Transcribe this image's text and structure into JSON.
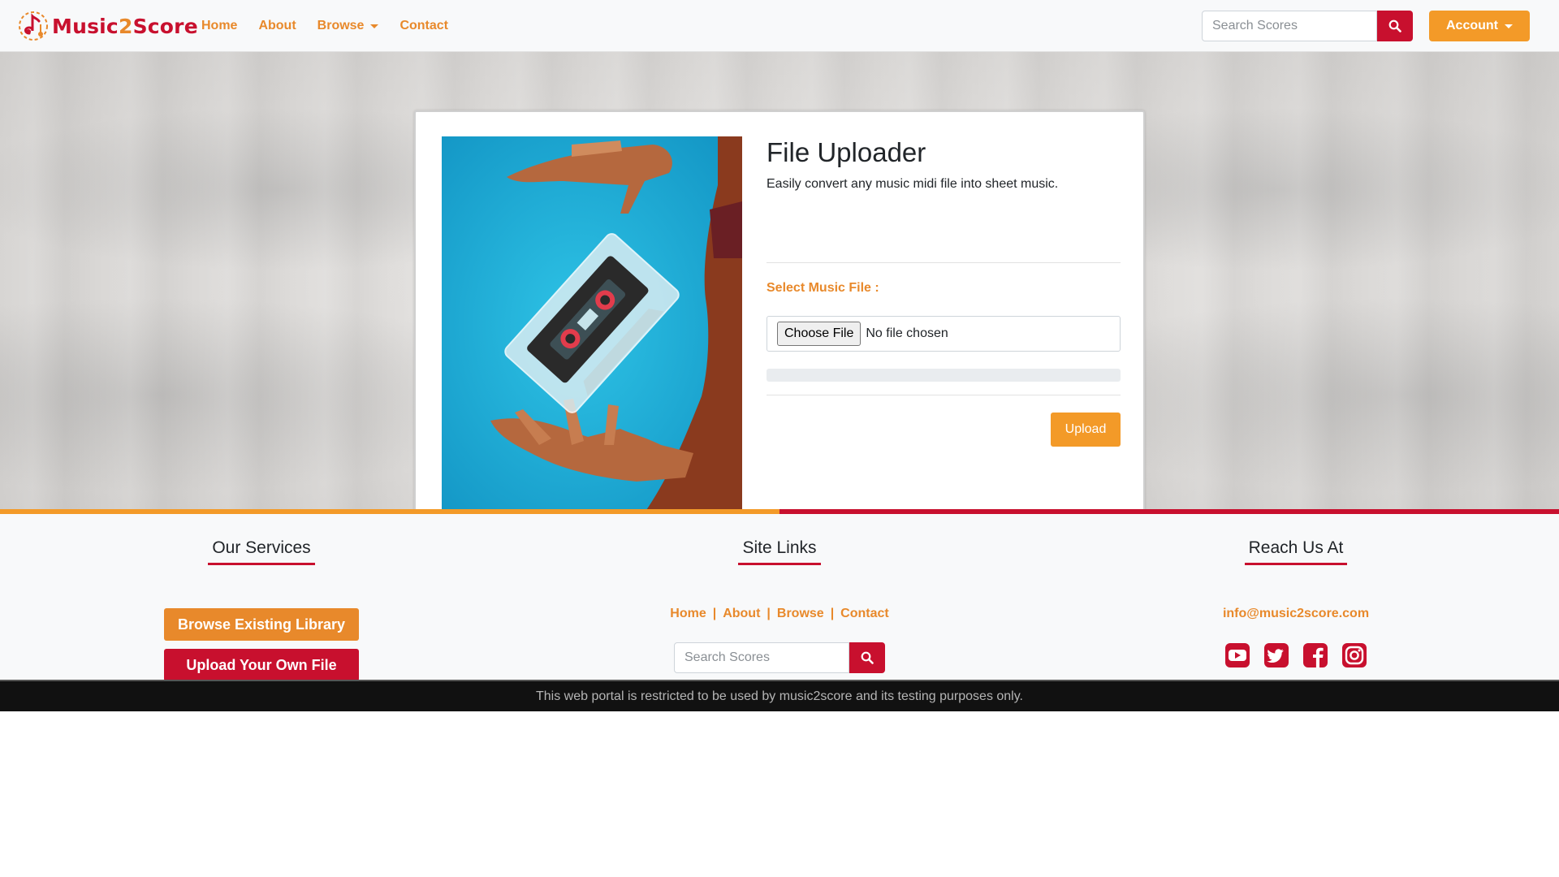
{
  "brand": {
    "name_part1": "Music",
    "name_part2": "2",
    "name_part3": "Score"
  },
  "nav": {
    "links": [
      {
        "label": "Home"
      },
      {
        "label": "About"
      },
      {
        "label": "Browse"
      },
      {
        "label": "Contact"
      }
    ],
    "search_placeholder": "Search Scores",
    "account_label": "Account"
  },
  "uploader": {
    "title": "File Uploader",
    "subtitle": "Easily convert any music midi file into sheet music.",
    "select_label": "Select Music File :",
    "choose_button": "Choose File",
    "file_status": "No file chosen",
    "progress": 0,
    "upload_button": "Upload"
  },
  "footer": {
    "services": {
      "title": "Our Services",
      "browse_button": "Browse Existing Library",
      "upload_button": "Upload Your Own File"
    },
    "site_links": {
      "title": "Site Links",
      "links": [
        "Home",
        "About",
        "Browse",
        "Contact"
      ],
      "separator": "|",
      "search_placeholder": "Search Scores"
    },
    "reach": {
      "title": "Reach Us At",
      "email": "info@music2score.com",
      "social_icons": [
        "youtube-icon",
        "twitter-icon",
        "facebook-icon",
        "instagram-icon"
      ]
    },
    "disclaimer": "This web portal is restricted to be used by music2score and its testing purposes only."
  },
  "colors": {
    "accent_orange": "#f39a28",
    "link_orange": "#e8892b",
    "brand_red": "#c8102e",
    "bottom_bar": "#111111"
  }
}
